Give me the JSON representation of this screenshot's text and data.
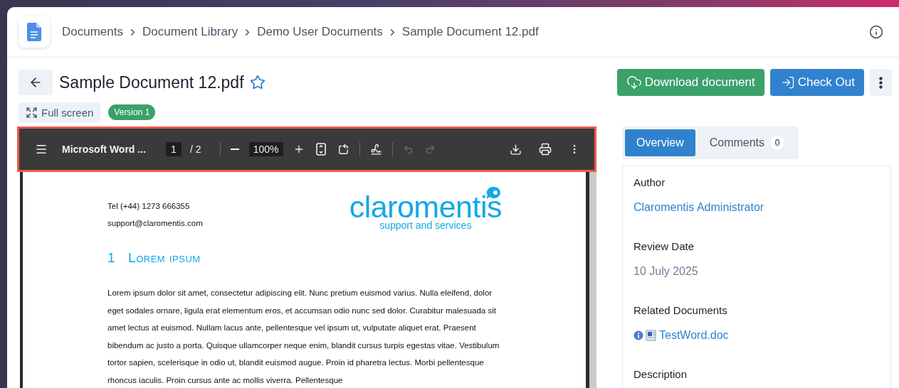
{
  "breadcrumb": [
    "Documents",
    "Document Library",
    "Demo User Documents",
    "Sample Document 12.pdf"
  ],
  "title": "Sample Document 12.pdf",
  "favorite": false,
  "actions": [
    {
      "kind": "download",
      "label": "Download document"
    },
    {
      "kind": "checkout",
      "label": "Check Out"
    },
    {
      "kind": "more"
    }
  ],
  "full_screen": "Full screen",
  "version": "Version 1",
  "viewer": {
    "file_name": "Microsoft Word ...",
    "page": "1",
    "page_count": "/ 2",
    "zoom": "100%",
    "tools": [
      {
        "kind": "fit",
        "disabled": false
      },
      {
        "kind": "rotate",
        "disabled": false
      },
      {
        "kind": "sep"
      },
      {
        "kind": "draw",
        "disabled": false
      },
      {
        "kind": "sep"
      },
      {
        "kind": "undo",
        "disabled": true
      },
      {
        "kind": "redo",
        "disabled": true
      }
    ],
    "document": {
      "phone": "Tel (+44) 1273 666355",
      "email": "support@claromentis.com",
      "logo": "claromentis",
      "tagline": "support and services",
      "heading_number": "1",
      "heading": "Lorem ipsum",
      "paragraph": "Lorem ipsum dolor sit amet, consectetur adipiscing elit. Nunc pretium euismod varius. Nulla eleifend, dolor eget sodales ornare, ligula erat elementum eros, et accumsan odio nunc sed dolor. Curabitur malesuada sit amet lectus at euismod. Nullam lacus ante, pellentesque vel ipsum ut, vulputate aliquet erat. Praesent bibendum ac justo a porta. Quisque ullamcorper neque enim, blandit cursus turpis egestas vitae. Vestibulum tortor sapien, scelerisque in odio ut, blandit euismod augue. Proin id pharetra lectus. Morbi pellentesque rhoncus iaculis. Proin cursus ante ac mollis viverra. Pellentesque"
    }
  },
  "tabs": [
    {
      "label": "Overview",
      "selected": true
    },
    {
      "label": "Comments",
      "count": "0",
      "selected": false
    }
  ],
  "fields": [
    {
      "label": "Author",
      "kind": "link",
      "value": "Claromentis Administrator"
    },
    {
      "label": "Review Date",
      "kind": "text",
      "value": "10 July 2025"
    },
    {
      "label": "Related Documents",
      "kind": "file",
      "value": "TestWord.doc"
    },
    {
      "label": "Description",
      "kind": "empty"
    }
  ]
}
